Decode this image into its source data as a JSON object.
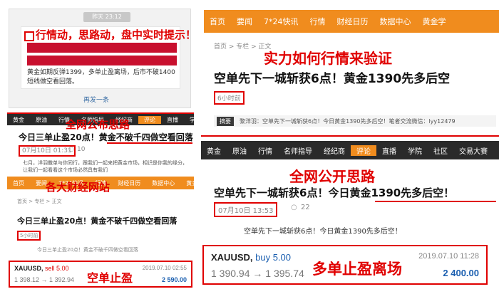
{
  "colors": {
    "accent": "#e00000",
    "nav_orange": "#f08c1e",
    "nav_dark": "#2a2a2a"
  },
  "top_left": {
    "time_badge": "昨天 23:12",
    "annotation": "行情动，思路动，盘中实时提示！",
    "message": "黄金如期反弹1399，多单止盈离场，后市不破1400短线做空看回落。",
    "resend": "再发一条"
  },
  "mid_left": {
    "nav1": [
      "黄金",
      "原油",
      "行情",
      "名师指导",
      "经纪商",
      "评论",
      "直播",
      "学院"
    ],
    "overlay1": "全网公布思路",
    "headline": "今日三单止盈20点！黄金不破千四做空看回落",
    "date": "07月10日 01:31",
    "comments": "10",
    "body": "七月，洋羽撒单与你同行，跟我们一起来把黄金市场，相识是你我的缘分，让我们一起看看这个市场必然具有我们",
    "nav2": [
      "首页",
      "要闻",
      "7*24快讯",
      "行情",
      "财经日历",
      "数据中心",
      "黄金学"
    ],
    "overlay2": "各大财经网站",
    "crumb": "首页 > 专栏 > 正文",
    "headline2": "今日三单止盈20点！黄金不破千四做空看回落",
    "time2": "5小时前",
    "summary": "今日三单止盈20点！黄金不破千四做空看回落",
    "ticker": {
      "symbol": "XAUUSD,",
      "side": "sell 5.00",
      "time": "2019.07.10 02:55",
      "prices": "1 398.12 → 1 392.94",
      "profit": "2 590.00"
    },
    "annotation": "空单止盈"
  },
  "right_top": {
    "nav": [
      "首页",
      "要闻",
      "7*24快讯",
      "行情",
      "财经日历",
      "数据中心",
      "黄金学"
    ],
    "crumb": "首页 > 专栏 > 正文",
    "annotation": "实力如何行情来验证",
    "headline": "空单先下一城斩获6点！黄金1390先多后空",
    "time": "6小时前",
    "summary_label": "摘要",
    "summary": "黎洋羽：空单先下一城斩获6点！今日黄金1390先多后空！笔者交流微信：lyy12479"
  },
  "right_mid": {
    "nav": [
      "黄金",
      "原油",
      "行情",
      "名师指导",
      "经纪商",
      "评论",
      "直播",
      "学院",
      "社区",
      "交易大赛"
    ],
    "annotation": "全网公开思路",
    "headline": "空单先下一城斩获6点！今日黄金1390先多后空！",
    "date": "07月10日 13:53",
    "comments": "22",
    "body": "空单先下一城斩获6点！今日黄金1390先多后空！"
  },
  "right_bottom": {
    "symbol": "XAUUSD,",
    "side": "buy 5.00",
    "time": "2019.07.10 11:28",
    "prices": "1 390.94 → 1 395.74",
    "profit": "2 400.00",
    "annotation": "多单止盈离场"
  }
}
